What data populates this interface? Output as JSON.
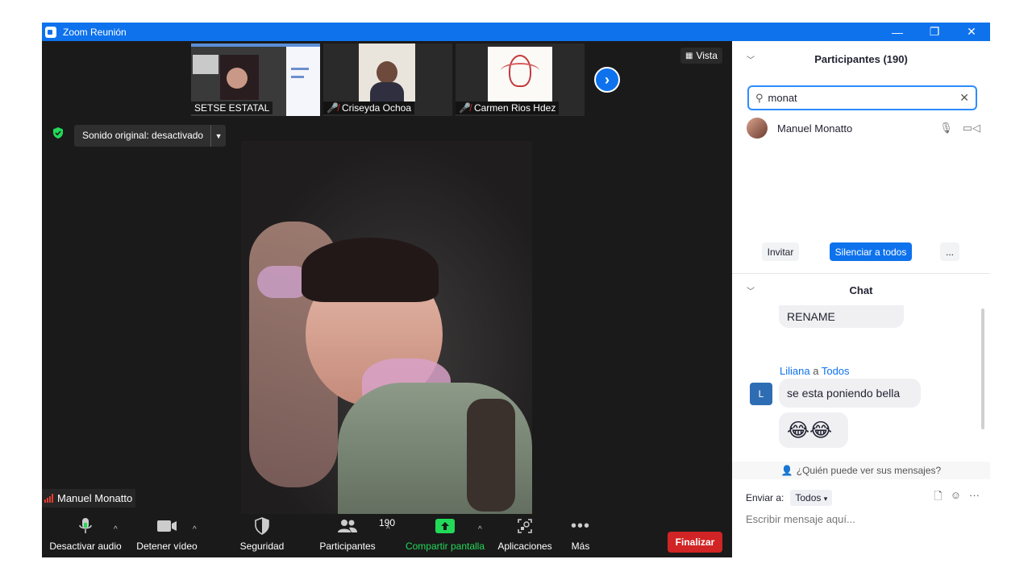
{
  "window": {
    "title": "Zoom Reunión",
    "minimize": "—",
    "restore": "❐",
    "close": "✕"
  },
  "gallery": {
    "thumbs": [
      {
        "name": "SETSE ESTATAL",
        "muted": false
      },
      {
        "name": "Criseyda Ochoa",
        "muted": true
      },
      {
        "name": "Carmen Rios Hdez",
        "muted": true
      }
    ],
    "view_label": "Vista"
  },
  "sound_original": "Sonido original: desactivado",
  "active_speaker": "Manuel Monatto",
  "toolbar": {
    "audio": "Desactivar audio",
    "video": "Detener vídeo",
    "security": "Seguridad",
    "participants": "Participantes",
    "participants_count": "190",
    "share": "Compartir pantalla",
    "apps": "Aplicaciones",
    "more": "Más",
    "end": "Finalizar"
  },
  "participants_panel": {
    "title": "Participantes (190)",
    "search_value": "monat",
    "items": [
      {
        "name": "Manuel Monatto"
      }
    ],
    "invite": "Invitar",
    "mute_all": "Silenciar a todos",
    "more": "..."
  },
  "chat": {
    "title": "Chat",
    "messages": [
      {
        "text": "RENAME"
      },
      {
        "sender": "Liliana",
        "to_word": "a",
        "recipient": "Todos",
        "avatar": "L",
        "text": "se esta poniendo  bella"
      },
      {
        "text": "😂😂"
      }
    ],
    "who_sees": "¿Quién puede ver sus mensajes?",
    "send_to_label": "Enviar a:",
    "send_to_value": "Todos",
    "input_placeholder": "Escribir mensaje aquí..."
  },
  "colors": {
    "accent": "#0e72ed",
    "end": "#d12424",
    "share": "#23d959"
  }
}
